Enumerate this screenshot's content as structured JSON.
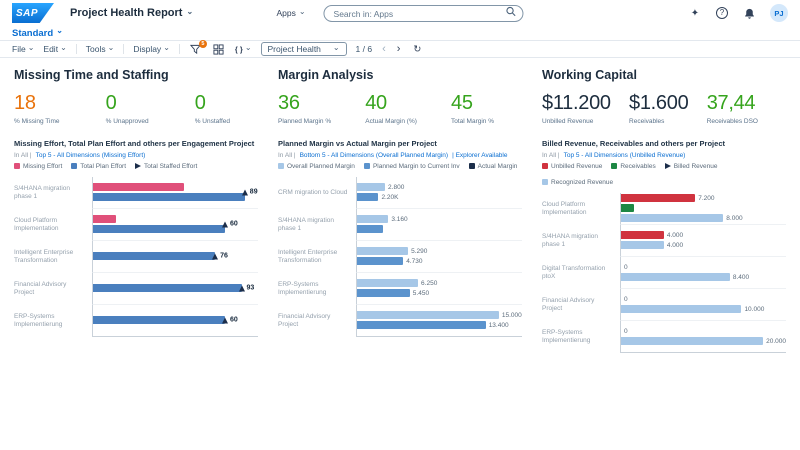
{
  "colors": {
    "accent": "#0a6ed1",
    "kpi_green": "#36a41d",
    "kpi_orange": "#e9730c",
    "kpi_dark": "#1d2d3e",
    "bar_blue": "#4a7fbe",
    "bar_light_blue": "#a6c7e7",
    "bar_medium_blue": "#5b93cd",
    "bar_pink": "#e0507a",
    "bar_red": "#d0333f",
    "bar_green": "#1d8743",
    "marker_navy": "#1c2e4a"
  },
  "icons": {
    "search-icon": "magnifier",
    "assistant-icon": "sparkle",
    "help-icon": "question-mark",
    "notifications-icon": "bell",
    "filter-icon": "funnel",
    "grid-icon": "grid",
    "code-icon": "braces",
    "refresh-icon": "circular-arrow",
    "caret-icon": "chevron-down"
  },
  "shell": {
    "logo_text": "SAP",
    "app_title": "Project Health Report",
    "apps_label": "Apps",
    "search_placeholder": "Search in: Apps",
    "avatar_initials": "PJ"
  },
  "view_bar": {
    "view_name": "Standard"
  },
  "toolbar": {
    "menus": [
      {
        "label": "File"
      },
      {
        "label": "Edit"
      },
      {
        "label": "Tools"
      },
      {
        "label": "Display"
      }
    ],
    "filter_badge": "5",
    "page_select_value": "Project Health",
    "page_indicator": "1 / 6"
  },
  "panels": [
    {
      "title": "Missing Time and Staffing",
      "kpis": [
        {
          "value": "18",
          "label": "% Missing Time",
          "color": "#e9730c"
        },
        {
          "value": "0",
          "label": "% Unapproved",
          "color": "#36a41d"
        },
        {
          "value": "0",
          "label": "% Unstaffed",
          "color": "#36a41d"
        }
      ],
      "chart": {
        "type": "bar",
        "title": "Missing Effort, Total Plan Effort and others per Engagement Project",
        "filter_prefix": "In All |",
        "filter_link": "Top 5 - All Dimensions (Missing Effort)",
        "filter_extra": "",
        "legend": [
          {
            "label": "Missing Effort",
            "color": "#e0507a",
            "shape": "square"
          },
          {
            "label": "Total Plan Effort",
            "color": "#4a7fbe",
            "shape": "square"
          },
          {
            "label": "Total Staffed Effort",
            "color": "#1c2e4a",
            "shape": "triangle"
          }
        ],
        "rows": [
          {
            "category": "S/4HANA migration phase 1",
            "bars": [
              {
                "color": "#e0507a",
                "pct": 55,
                "label": ""
              },
              {
                "color": "#4a7fbe",
                "pct": 92,
                "label": ""
              }
            ],
            "marker": {
              "pct": 92,
              "label": "89"
            }
          },
          {
            "category": "Cloud Platform Implementation",
            "bars": [
              {
                "color": "#e0507a",
                "pct": 14,
                "label": ""
              },
              {
                "color": "#4a7fbe",
                "pct": 80,
                "label": ""
              }
            ],
            "marker": {
              "pct": 80,
              "label": "60"
            }
          },
          {
            "category": "Intelligent Enterprise Transformation",
            "bars": [
              {
                "color": "#4a7fbe",
                "pct": 74,
                "label": ""
              }
            ],
            "marker": {
              "pct": 74,
              "label": "76"
            }
          },
          {
            "category": "Financial Advisory Project",
            "bars": [
              {
                "color": "#4a7fbe",
                "pct": 90,
                "label": ""
              }
            ],
            "marker": {
              "pct": 90,
              "label": "93"
            }
          },
          {
            "category": "ERP-Systems Implementierung",
            "bars": [
              {
                "color": "#4a7fbe",
                "pct": 80,
                "label": ""
              }
            ],
            "marker": {
              "pct": 80,
              "label": "60"
            }
          }
        ]
      }
    },
    {
      "title": "Margin Analysis",
      "kpis": [
        {
          "value": "36",
          "label": "Planned Margin %",
          "color": "#36a41d"
        },
        {
          "value": "40",
          "label": "Actual Margin (%)",
          "color": "#36a41d"
        },
        {
          "value": "45",
          "label": "Total Margin %",
          "color": "#36a41d"
        }
      ],
      "chart": {
        "type": "bar",
        "title": "Planned Margin vs Actual Margin per Project",
        "filter_prefix": "In All |",
        "filter_link": "Bottom 5 - All Dimensions (Overall Planned Margin)",
        "filter_extra": "| Explorer Available",
        "legend": [
          {
            "label": "Overall Planned Margin",
            "color": "#a6c7e7",
            "shape": "square"
          },
          {
            "label": "Planned Margin to Current Inv",
            "color": "#5b93cd",
            "shape": "square"
          },
          {
            "label": "Actual Margin",
            "color": "#1c2e4a",
            "shape": "square"
          }
        ],
        "rows": [
          {
            "category": "CRM migration to Cloud",
            "bars": [
              {
                "color": "#a6c7e7",
                "pct": 17,
                "label": "2.800"
              },
              {
                "color": "#5b93cd",
                "pct": 13,
                "label": "2.20K"
              }
            ]
          },
          {
            "category": "S/4HANA migration phase 1",
            "bars": [
              {
                "color": "#a6c7e7",
                "pct": 19,
                "label": "3.160"
              },
              {
                "color": "#5b93cd",
                "pct": 16,
                "label": ""
              }
            ]
          },
          {
            "category": "Intelligent Enterprise Transformation",
            "bars": [
              {
                "color": "#a6c7e7",
                "pct": 31,
                "label": "5.290"
              },
              {
                "color": "#5b93cd",
                "pct": 28,
                "label": "4.730"
              }
            ]
          },
          {
            "category": "ERP-Systems Implementierung",
            "bars": [
              {
                "color": "#a6c7e7",
                "pct": 37,
                "label": "6.250"
              },
              {
                "color": "#5b93cd",
                "pct": 32,
                "label": "5.450"
              }
            ]
          },
          {
            "category": "Financial Advisory Project",
            "bars": [
              {
                "color": "#a6c7e7",
                "pct": 86,
                "label": "15.000"
              },
              {
                "color": "#5b93cd",
                "pct": 78,
                "label": "13.400"
              }
            ]
          }
        ]
      }
    },
    {
      "title": "Working Capital",
      "kpis": [
        {
          "value": "$11.200",
          "label": "Unbilled Revenue",
          "color": "#1d2d3e"
        },
        {
          "value": "$1.600",
          "label": "Receivables",
          "color": "#1d2d3e"
        },
        {
          "value": "37,44",
          "label": "Receivables DSO",
          "color": "#36a41d"
        }
      ],
      "chart": {
        "type": "bar",
        "title": "Billed Revenue, Receivables and others per Project",
        "filter_prefix": "In All |",
        "filter_link": "Top 5 - All Dimensions (Unbilled Revenue)",
        "filter_extra": "",
        "legend": [
          {
            "label": "Unbilled Revenue",
            "color": "#d0333f",
            "shape": "square"
          },
          {
            "label": "Receivables",
            "color": "#1d8743",
            "shape": "square"
          },
          {
            "label": "Billed Revenue",
            "color": "#1c2e4a",
            "shape": "triangle"
          },
          {
            "label": "Recognized Revenue",
            "color": "#a6c7e7",
            "shape": "square"
          }
        ],
        "rows": [
          {
            "category": "Cloud Platform Implementation",
            "bars": [
              {
                "color": "#d0333f",
                "pct": 45,
                "label": "7.200"
              },
              {
                "color": "#1d8743",
                "pct": 8,
                "label": ""
              },
              {
                "color": "#a6c7e7",
                "pct": 62,
                "label": "8.000"
              }
            ]
          },
          {
            "category": "S/4HANA migration phase 1",
            "bars": [
              {
                "color": "#d0333f",
                "pct": 26,
                "label": "4.000"
              },
              {
                "color": "#a6c7e7",
                "pct": 26,
                "label": "4.000"
              }
            ]
          },
          {
            "category": "Digital Transformation ptoX",
            "bars": [
              {
                "color": "#d0333f",
                "pct": 0,
                "label": "0"
              },
              {
                "color": "#a6c7e7",
                "pct": 66,
                "label": "8.400"
              }
            ]
          },
          {
            "category": "Financial Advisory Project",
            "bars": [
              {
                "color": "#d0333f",
                "pct": 0,
                "label": "0"
              },
              {
                "color": "#a6c7e7",
                "pct": 73,
                "label": "10.000"
              }
            ]
          },
          {
            "category": "ERP-Systems Implementierung",
            "bars": [
              {
                "color": "#d0333f",
                "pct": 0,
                "label": "0"
              },
              {
                "color": "#a6c7e7",
                "pct": 87,
                "label": "20.000"
              }
            ]
          }
        ]
      }
    }
  ]
}
